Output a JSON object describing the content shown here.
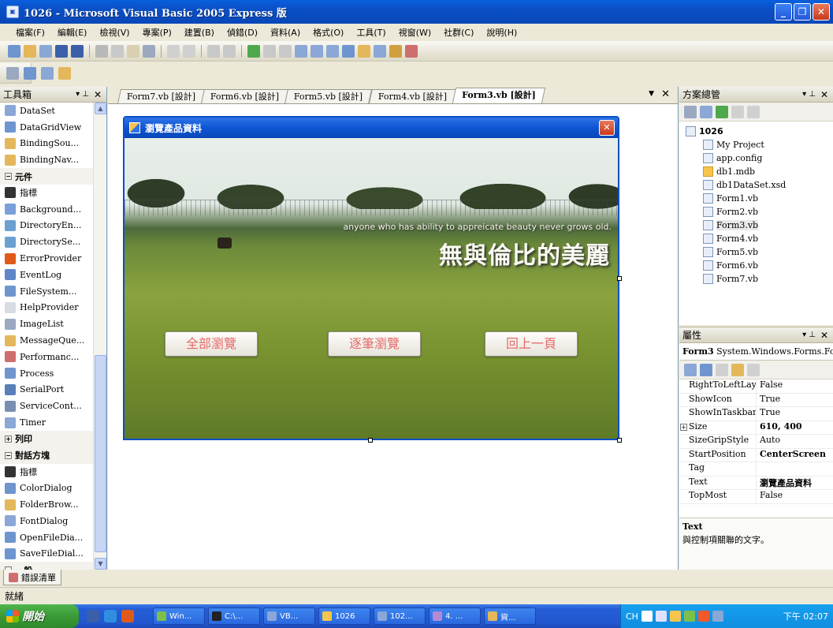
{
  "window": {
    "title": "1026 - Microsoft Visual Basic 2005 Express 版",
    "icon": "vb-app-icon"
  },
  "menu": [
    "檔案(F)",
    "編輯(E)",
    "檢視(V)",
    "專案(P)",
    "建置(B)",
    "偵錯(D)",
    "資料(A)",
    "格式(O)",
    "工具(T)",
    "視窗(W)",
    "社群(C)",
    "說明(H)"
  ],
  "toolbox": {
    "title": "工具箱",
    "items": [
      {
        "label": "DataSet",
        "icon": "dataset-icon",
        "color": "#8aa7d6"
      },
      {
        "label": "DataGridView",
        "icon": "grid-icon",
        "color": "#6f95cf"
      },
      {
        "label": "BindingSou...",
        "icon": "binding-source-icon",
        "color": "#e3b75a"
      },
      {
        "label": "BindingNav...",
        "icon": "binding-navigator-icon",
        "color": "#e3b75a"
      },
      {
        "label": "元件",
        "group": true,
        "sym": "−"
      },
      {
        "label": "指標",
        "icon": "pointer-icon",
        "color": "#333333"
      },
      {
        "label": "Background...",
        "icon": "background-worker-icon",
        "color": "#7aa0d8"
      },
      {
        "label": "DirectoryEn...",
        "icon": "directory-entry-icon",
        "color": "#6ca0d0"
      },
      {
        "label": "DirectorySe...",
        "icon": "directory-searcher-icon",
        "color": "#6ca0d0"
      },
      {
        "label": "ErrorProvider",
        "icon": "error-icon",
        "color": "#e05a1a"
      },
      {
        "label": "EventLog",
        "icon": "eventlog-icon",
        "color": "#5f86c6"
      },
      {
        "label": "FileSystem...",
        "icon": "filesystem-icon",
        "color": "#6f95cf"
      },
      {
        "label": "HelpProvider",
        "icon": "help-icon",
        "color": "#d7dbe3"
      },
      {
        "label": "ImageList",
        "icon": "imagelist-icon",
        "color": "#9aa9bf"
      },
      {
        "label": "MessageQue...",
        "icon": "message-queue-icon",
        "color": "#e3b75a"
      },
      {
        "label": "Performanc...",
        "icon": "performance-icon",
        "color": "#cf6e6e"
      },
      {
        "label": "Process",
        "icon": "process-icon",
        "color": "#6f95cf"
      },
      {
        "label": "SerialPort",
        "icon": "serialport-icon",
        "color": "#5a7fb8"
      },
      {
        "label": "ServiceCont...",
        "icon": "service-icon",
        "color": "#7a8fb0"
      },
      {
        "label": "Timer",
        "icon": "timer-icon",
        "color": "#8aa7d6"
      },
      {
        "label": "列印",
        "group": true,
        "sym": "+"
      },
      {
        "label": "對話方塊",
        "group": true,
        "sym": "−"
      },
      {
        "label": "指標",
        "icon": "pointer-icon",
        "color": "#333333"
      },
      {
        "label": "ColorDialog",
        "icon": "color-dialog-icon",
        "color": "#6f95cf"
      },
      {
        "label": "FolderBrow...",
        "icon": "folder-browser-icon",
        "color": "#e3b75a"
      },
      {
        "label": "FontDialog",
        "icon": "font-dialog-icon",
        "color": "#8aa7d6"
      },
      {
        "label": "OpenFileDia...",
        "icon": "open-file-icon",
        "color": "#6f95cf"
      },
      {
        "label": "SaveFileDial...",
        "icon": "save-file-icon",
        "color": "#6f95cf"
      },
      {
        "label": "一般",
        "group": true,
        "sym": "−"
      }
    ]
  },
  "tabs": [
    {
      "label": "Form7.vb [設計]"
    },
    {
      "label": "Form6.vb [設計]"
    },
    {
      "label": "Form5.vb [設計]"
    },
    {
      "label": "Form4.vb [設計]"
    },
    {
      "label": "Form3.vb [設計]",
      "active": true
    }
  ],
  "designer": {
    "form_title": "瀏覽產品資料",
    "slogan_en": "anyone who has ability to appreicate beauty never grows old.",
    "slogan_zh": "無與倫比的美麗",
    "buttons": [
      "全部瀏覽",
      "逐筆瀏覽",
      "回上一頁"
    ]
  },
  "solution": {
    "title": "方案總管",
    "root": "1026",
    "items": [
      {
        "label": "My Project",
        "folder": false
      },
      {
        "label": "app.config",
        "folder": false
      },
      {
        "label": "db1.mdb",
        "folder": true
      },
      {
        "label": "db1DataSet.xsd",
        "folder": false
      },
      {
        "label": "Form1.vb",
        "folder": false
      },
      {
        "label": "Form2.vb",
        "folder": false
      },
      {
        "label": "Form3.vb",
        "folder": false,
        "selected": true
      },
      {
        "label": "Form4.vb",
        "folder": false
      },
      {
        "label": "Form5.vb",
        "folder": false
      },
      {
        "label": "Form6.vb",
        "folder": false
      },
      {
        "label": "Form7.vb",
        "folder": false
      }
    ]
  },
  "properties": {
    "title": "屬性",
    "object": "Form3",
    "object_type": "System.Windows.Forms.Fon",
    "rows": [
      {
        "name": "RightToLeftLay",
        "value": "False"
      },
      {
        "name": "ShowIcon",
        "value": "True"
      },
      {
        "name": "ShowInTaskbar",
        "value": "True"
      },
      {
        "name": "Size",
        "value": "610, 400",
        "bold": true,
        "expand": "+"
      },
      {
        "name": "SizeGripStyle",
        "value": "Auto"
      },
      {
        "name": "StartPosition",
        "value": "CenterScreen",
        "bold": true
      },
      {
        "name": "Tag",
        "value": ""
      },
      {
        "name": "Text",
        "value": "瀏覽產品資料",
        "bold": true
      },
      {
        "name": "TopMost",
        "value": "False"
      }
    ],
    "desc_title": "Text",
    "desc_text": "與控制項關聯的文字。"
  },
  "error_tab": "錯誤清單",
  "status": "就緒",
  "taskbar": {
    "start": "開始",
    "tasks": [
      {
        "label": "Win...",
        "color": "#7cc04a"
      },
      {
        "label": "C:\\...",
        "color": "#222222"
      },
      {
        "label": "VB...",
        "color": "#8aa7d6"
      },
      {
        "label": "1026",
        "color": "#f6c64c"
      },
      {
        "label": "102...",
        "color": "#8aa7d6"
      },
      {
        "label": "4. ...",
        "color": "#b48ad6"
      },
      {
        "label": "資...",
        "color": "#e3b75a"
      }
    ],
    "ime": "CH",
    "clock": "下午 02:07"
  }
}
